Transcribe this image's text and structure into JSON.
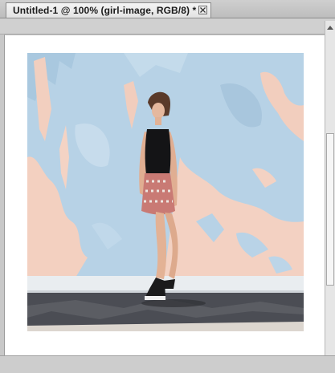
{
  "document": {
    "tab_title": "Untitled-1 @ 100% (girl-image, RGB/8) *",
    "close_icon": "close-icon"
  },
  "canvas": {
    "layer_name": "girl-image",
    "zoom": "100%",
    "color_mode": "RGB/8",
    "image_description_icon": "photo-girl-against-painted-wall"
  },
  "colors": {
    "wall_blue": "#b9d3e6",
    "wall_peach": "#f3d1c2",
    "ground": "#4a4c53",
    "curb": "#e9edf0"
  }
}
